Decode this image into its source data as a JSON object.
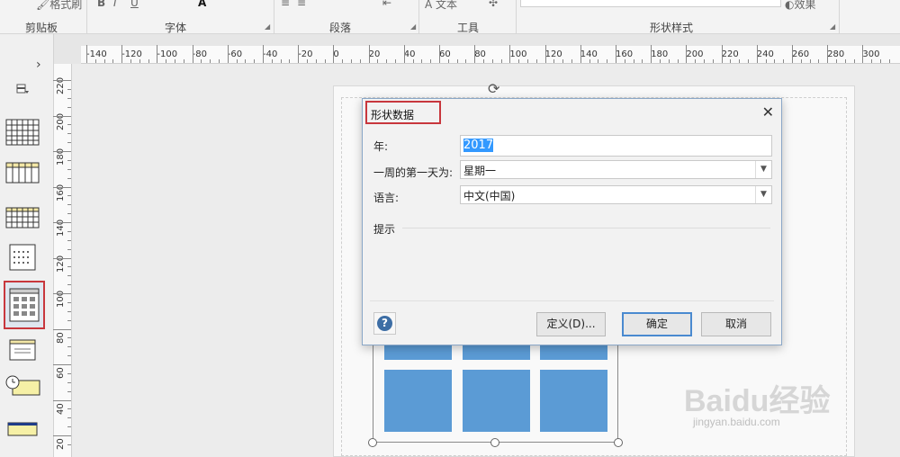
{
  "ribbon": {
    "format_painter": "格式刷",
    "text_tool": "文本",
    "effects": "效果",
    "groups": {
      "clipboard": "剪贴板",
      "font": "字体",
      "paragraph": "段落",
      "tools": "工具",
      "shape_styles": "形状样式"
    }
  },
  "rulers": {
    "horizontal": [
      "-140",
      "-120",
      "-100",
      "-80",
      "-60",
      "-40",
      "-20",
      "0",
      "20",
      "40",
      "60",
      "80",
      "100",
      "120",
      "140",
      "160",
      "180",
      "200",
      "220",
      "240",
      "260",
      "280",
      "300"
    ],
    "vertical": [
      "220",
      "200",
      "180",
      "160",
      "140",
      "120",
      "100",
      "80",
      "60",
      "40",
      "20"
    ]
  },
  "stencil": {
    "expand_icon": "chevron-right-icon",
    "shapes_icon": "shapes-icon"
  },
  "dialog": {
    "title": "形状数据",
    "year_label": "年:",
    "year_value": "2017",
    "first_day_label": "一周的第一天为:",
    "first_day_value": "星期一",
    "language_label": "语言:",
    "language_value": "中文(中国)",
    "hint_label": "提示",
    "define_button": "定义(D)...",
    "ok_button": "确定",
    "cancel_button": "取消",
    "help_icon": "?"
  },
  "watermark": {
    "brand": "Baidu经验",
    "url": "jingyan.baidu.com"
  },
  "colors": {
    "accent": "#5b9bd5",
    "highlight": "#c8373d",
    "selection": "#3399ff"
  }
}
